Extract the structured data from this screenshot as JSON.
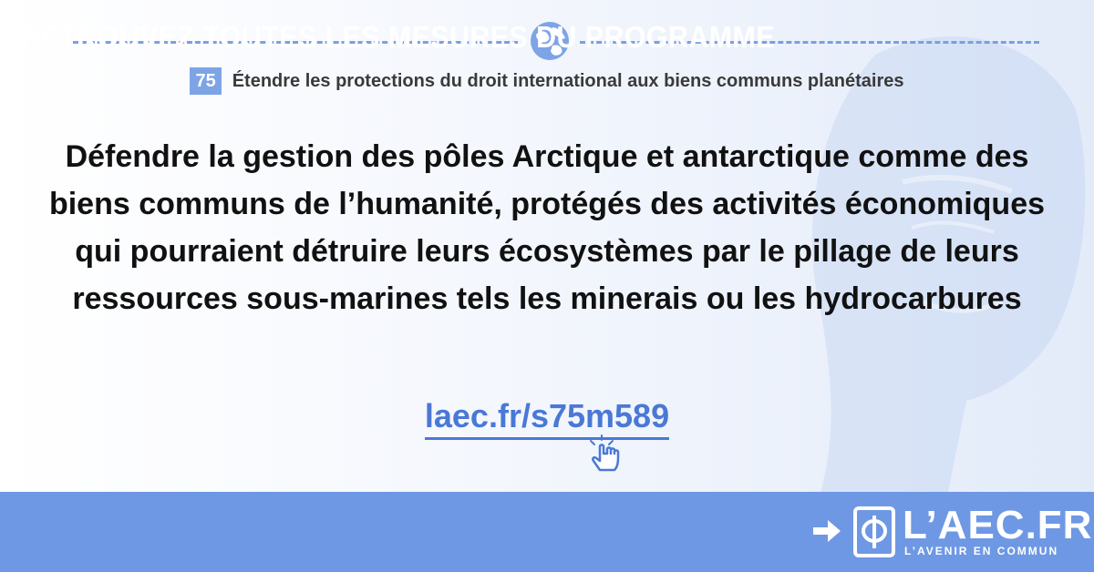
{
  "measure": {
    "number": "75",
    "title": "Étendre les protections du droit international aux biens communs planétaires"
  },
  "main_text": "Défendre la gestion des pôles Arctique et antarctique comme des biens communs de l’humanité, protégés des activités économiques qui pourraient détruire leurs écosystèmes par le pillage de leurs ressources sous-marines tels les minerais ou les hydrocarbures",
  "link": "laec.fr/s75m589",
  "banner": {
    "text": "RETROUVEZ TOUTES LES MESURES DU PROGRAMME",
    "logo": "L’AEC.FR",
    "logo_subtitle": "L’AVENIR EN COMMUN"
  },
  "colors": {
    "accent": "#6e98e4",
    "link": "#4a78d6",
    "text": "#111111"
  },
  "icons": [
    "globe-icon",
    "pointer-hand-icon",
    "arrow-right-icon",
    "phi-logo-icon"
  ]
}
